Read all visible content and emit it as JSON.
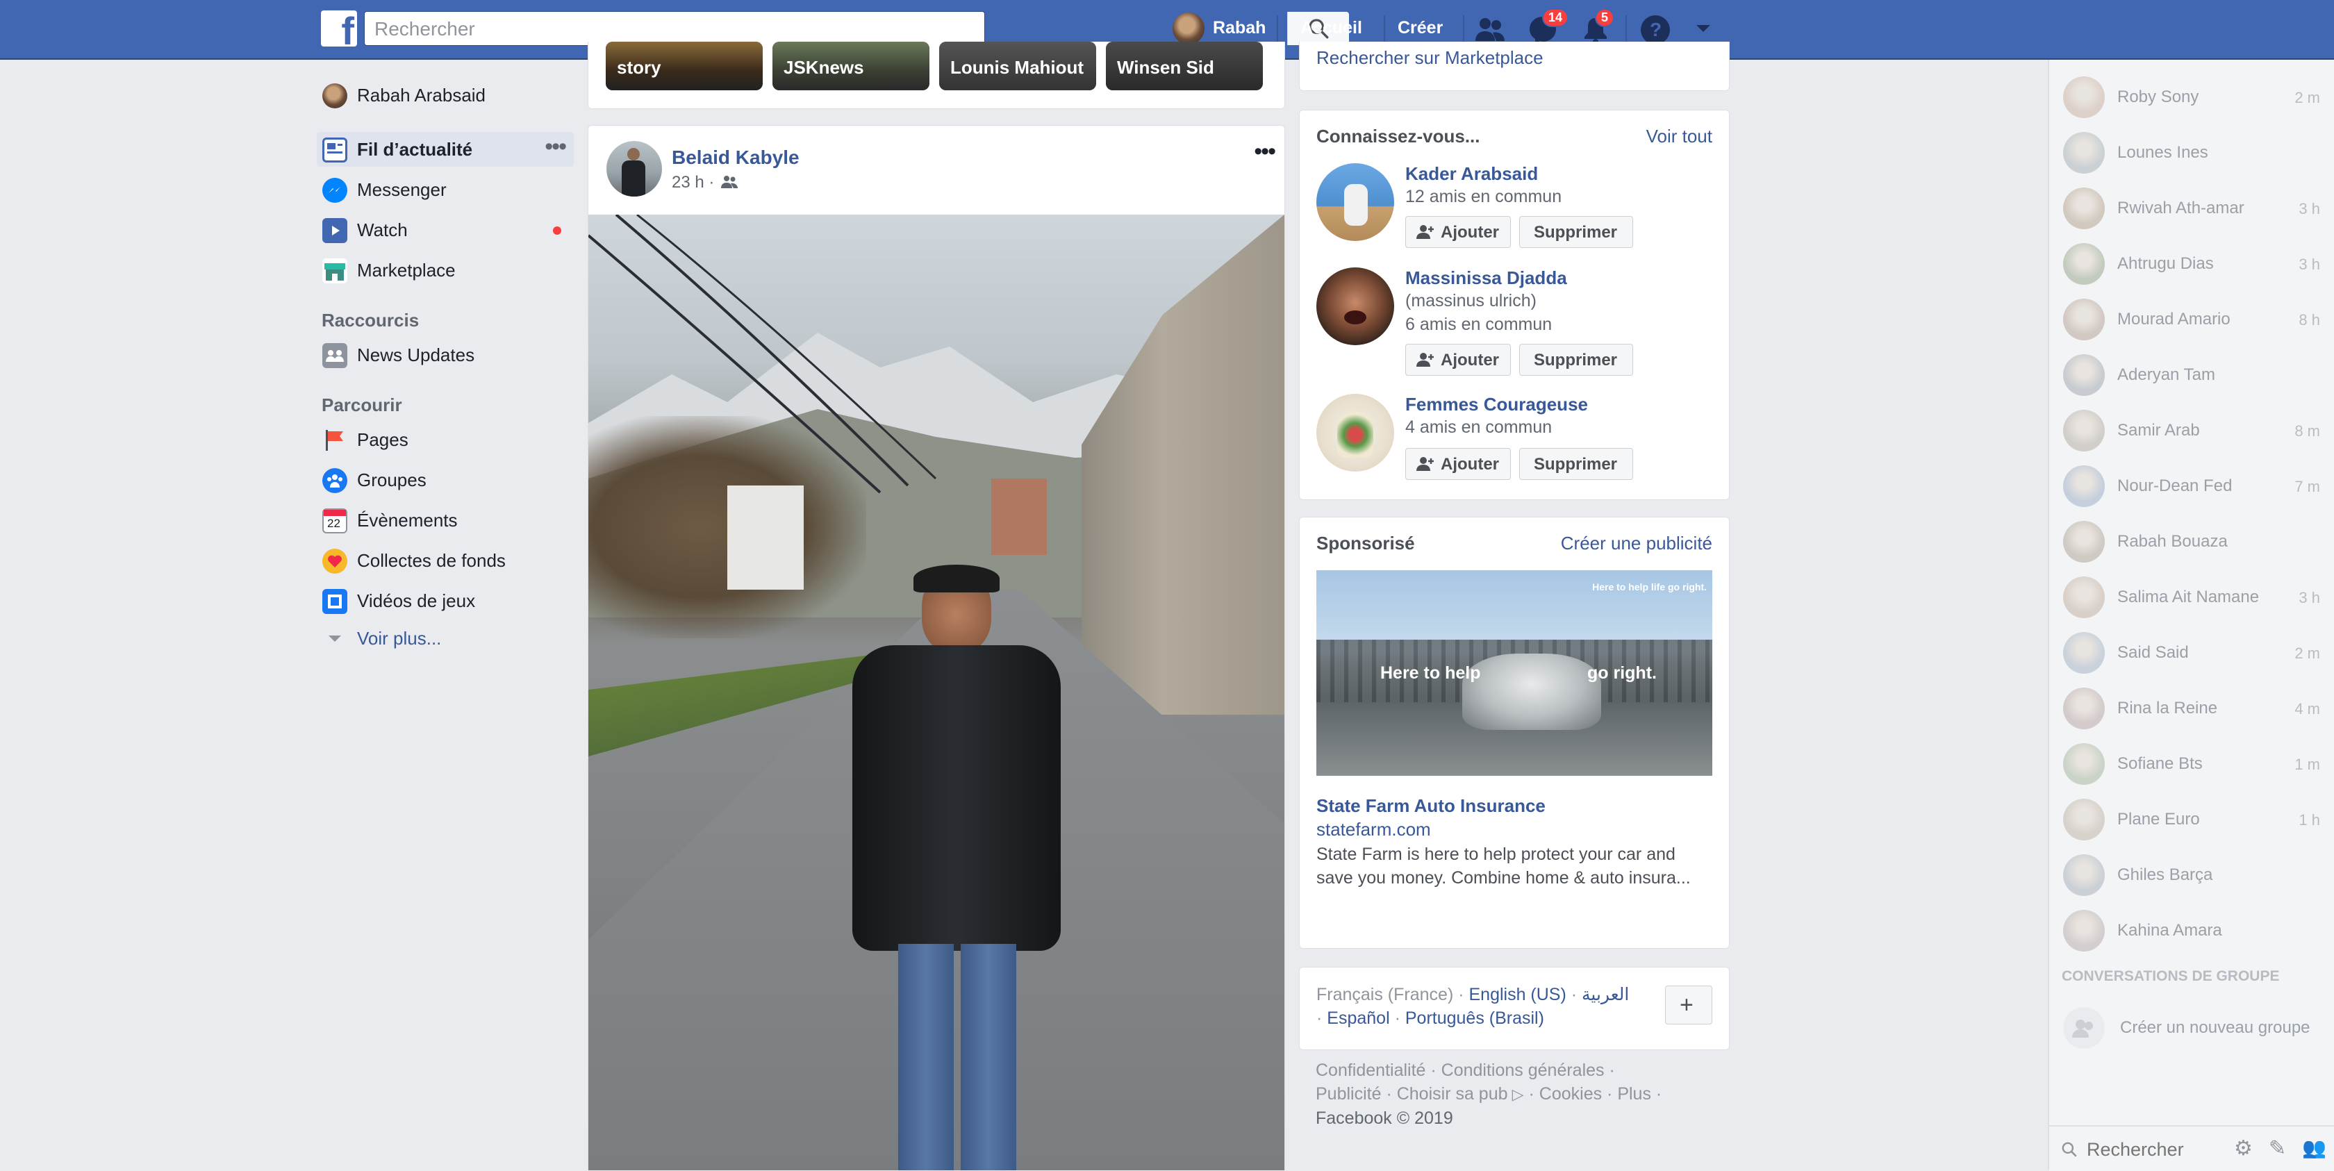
{
  "topbar": {
    "search_placeholder": "Rechercher",
    "user_name": "Rabah",
    "home_label": "Accueil",
    "create_label": "Créer",
    "messages_badge": "14",
    "notifications_badge": "5"
  },
  "leftnav": {
    "profile_name": "Rabah Arabsaid",
    "main": [
      {
        "label": "Fil d’actualité",
        "icon": "news-feed-icon"
      },
      {
        "label": "Messenger",
        "icon": "messenger-icon"
      },
      {
        "label": "Watch",
        "icon": "watch-icon"
      },
      {
        "label": "Marketplace",
        "icon": "marketplace-icon"
      }
    ],
    "shortcuts_heading": "Raccourcis",
    "shortcuts": [
      {
        "label": "News Updates",
        "icon": "group-icon"
      }
    ],
    "explore_heading": "Parcourir",
    "explore": [
      {
        "label": "Pages",
        "icon": "flag-icon"
      },
      {
        "label": "Groupes",
        "icon": "groups-icon"
      },
      {
        "label": "Évènements",
        "icon": "calendar-icon",
        "day": "22"
      },
      {
        "label": "Collectes de fonds",
        "icon": "fundraiser-icon"
      },
      {
        "label": "Vidéos de jeux",
        "icon": "gaming-video-icon"
      }
    ],
    "see_more": "Voir plus..."
  },
  "stories": [
    "story",
    "JSKnews",
    "Lounis Mahiout",
    "Winsen Sid"
  ],
  "post": {
    "author": "Belaid Kabyle",
    "time": "23 h ·"
  },
  "marketplace_link": "Rechercher sur Marketplace",
  "pymk": {
    "title": "Connaissez-vous...",
    "see_all": "Voir tout",
    "add_label": "Ajouter",
    "remove_label": "Supprimer",
    "people": [
      {
        "name": "Kader Arabsaid",
        "alt": "",
        "mutual": "12 amis en commun"
      },
      {
        "name": "Massinissa Djadda",
        "alt": "(massinus ulrich)",
        "mutual": "6 amis en commun"
      },
      {
        "name": "Femmes Courageuse",
        "alt": "",
        "mutual": "4 amis en commun"
      }
    ]
  },
  "sponsored": {
    "title": "Sponsorisé",
    "create_ad": "Créer une publicité",
    "ad_top_text": "Here to help life go right.",
    "ad_left_text": "Here to help",
    "ad_right_text": "go right.",
    "ad_name": "State Farm Auto Insurance",
    "ad_domain": "statefarm.com",
    "ad_text": "State Farm is here to help protect your car and save you money. Combine home & auto insura..."
  },
  "languages": {
    "current": "Français (France)",
    "others": [
      "English (US)",
      "العربية",
      "Español",
      "Português (Brasil)"
    ]
  },
  "footer": {
    "links": [
      "Confidentialité",
      "Conditions générales",
      "Publicité",
      "Choisir sa pub",
      "Cookies",
      "Plus"
    ],
    "copyright": "Facebook © 2019"
  },
  "chat": {
    "contacts": [
      {
        "name": "Roby Sony",
        "time": "2 m"
      },
      {
        "name": "Lounes Ines",
        "time": ""
      },
      {
        "name": "Rwivah Ath-amar",
        "time": "3 h"
      },
      {
        "name": "Ahtrugu Dias",
        "time": "3 h"
      },
      {
        "name": "Mourad Amario",
        "time": "8 h"
      },
      {
        "name": "Aderyan Tam",
        "time": ""
      },
      {
        "name": "Samir Arab",
        "time": "8 m"
      },
      {
        "name": "Nour-Dean Fed",
        "time": "7 m"
      },
      {
        "name": "Rabah Bouaza",
        "time": ""
      },
      {
        "name": "Salima Ait Namane",
        "time": "3 h"
      },
      {
        "name": "Said Said",
        "time": "2 m"
      },
      {
        "name": "Rina la Reine",
        "time": "4 m"
      },
      {
        "name": "Sofiane Bts",
        "time": "1 m"
      },
      {
        "name": "Plane Euro",
        "time": "1 h"
      },
      {
        "name": "Ghiles Barça",
        "time": ""
      },
      {
        "name": "Kahina Amara",
        "time": ""
      }
    ],
    "group_heading": "CONVERSATIONS DE GROUPE",
    "new_group": "Créer un nouveau groupe",
    "search_placeholder": "Rechercher"
  },
  "colors": {
    "brand": "#4267b2",
    "link": "#385898",
    "badge": "#fa3e3e"
  }
}
